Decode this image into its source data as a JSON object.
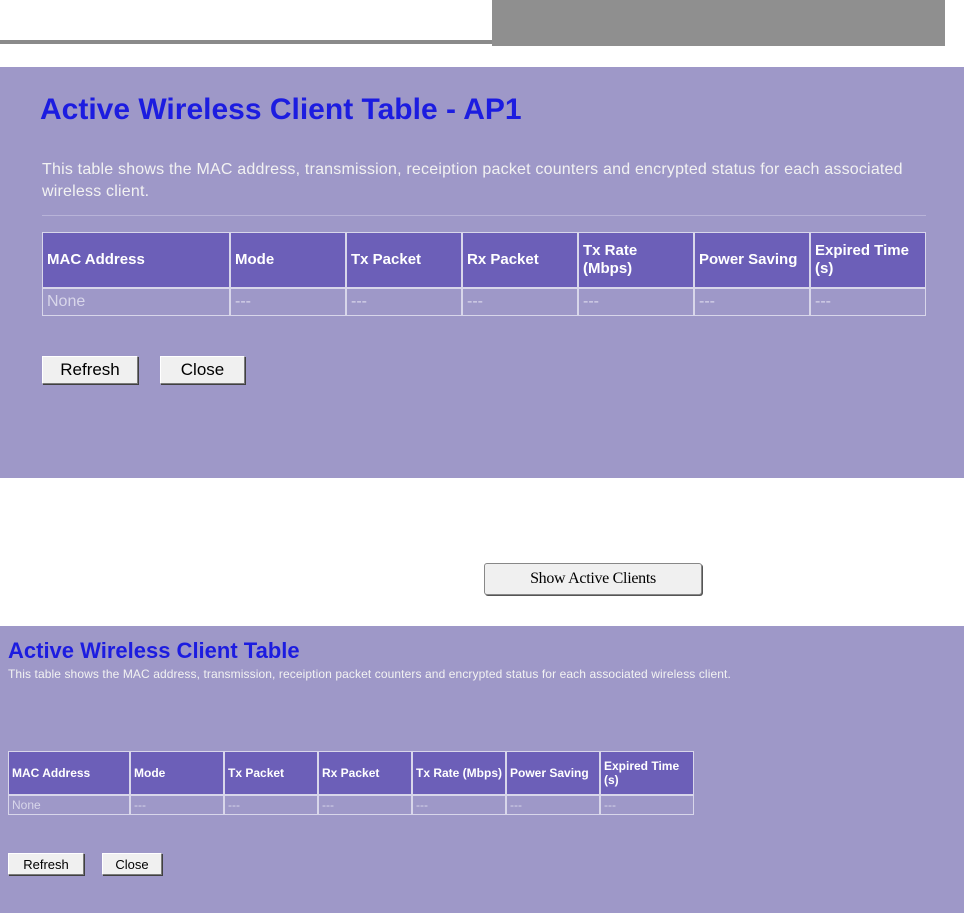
{
  "panel1": {
    "title": "Active Wireless Client Table - AP1",
    "description": "This table shows the MAC address, transmission, receiption packet counters and encrypted status for each associated wireless client.",
    "columns": [
      "MAC Address",
      "Mode",
      "Tx Packet",
      "Rx Packet",
      "Tx Rate (Mbps)",
      "Power Saving",
      "Expired Time (s)"
    ],
    "row": [
      "None",
      "---",
      "---",
      "---",
      "---",
      "---",
      "---"
    ],
    "refresh_label": "Refresh",
    "close_label": "Close"
  },
  "show_active_clients_label": "Show Active Clients",
  "panel2": {
    "title": "Active Wireless Client Table",
    "description": "This table shows the MAC address, transmission, receiption packet counters and encrypted status for each associated wireless client.",
    "columns": [
      "MAC Address",
      "Mode",
      "Tx Packet",
      "Rx Packet",
      "Tx Rate (Mbps)",
      "Power Saving",
      "Expired Time (s)"
    ],
    "row": [
      "None",
      "---",
      "---",
      "---",
      "---",
      "---",
      "---"
    ],
    "refresh_label": "Refresh",
    "close_label": "Close"
  },
  "colors": {
    "panel_bg": "#9e98c8",
    "header_bg": "#6c5fb8",
    "title": "#1c1ce0"
  }
}
